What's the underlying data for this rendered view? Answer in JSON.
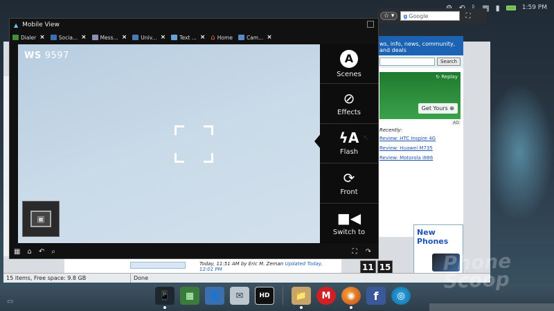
{
  "statusbar": {
    "time": "1:59 PM"
  },
  "camera_window": {
    "title": "Mobile View",
    "tabs": [
      {
        "label": "Dialer",
        "color": "#3f8f3f"
      },
      {
        "label": "Socia...",
        "color": "#3a6fb0"
      },
      {
        "label": "Mess...",
        "color": "#8a8fb8"
      },
      {
        "label": "Univ...",
        "color": "#4a7ab0"
      },
      {
        "label": "Text ...",
        "color": "#6aa0d8"
      },
      {
        "label": "Home",
        "color": "#d8d8d8"
      },
      {
        "label": "Cam...",
        "color": "#5a8ac8"
      }
    ],
    "viewfinder_label_prefix": "WS",
    "viewfinder_label_number": "9597",
    "controls": {
      "scenes": "Scenes",
      "effects": "Effects",
      "flash": "Flash",
      "front": "Front",
      "switch_to": "Switch to"
    }
  },
  "browser": {
    "google_placeholder": "Google",
    "tagline": "ws, info, news, community, and deals",
    "search_button": "Search",
    "ad_replay": "Replay",
    "ad_cta": "Get Yours",
    "ad_tag": "AD",
    "recently_title": "Recently:",
    "recent_links": [
      "Review: HTC Inspire 4G",
      "Review: Huawei M735",
      "Review: Motorola i886"
    ],
    "new_phones": "New Phones",
    "article_date": "Today, 11:51 AM",
    "article_author": "by Eric M. Zeman",
    "article_updated": "Updated Today, 12:01 PM",
    "clock_digits": [
      "11",
      "15"
    ],
    "status_items": "15 items, Free space: 9.8 GB",
    "status_done": "Done"
  },
  "dock": {
    "items": [
      {
        "name": "phone",
        "glyph": "📱"
      },
      {
        "name": "apps-grid",
        "glyph": "▦"
      },
      {
        "name": "contacts",
        "glyph": "👤"
      },
      {
        "name": "mail",
        "glyph": "✉"
      },
      {
        "name": "hd",
        "glyph": "HD"
      },
      {
        "name": "folder",
        "glyph": "📁"
      },
      {
        "name": "motorola",
        "glyph": "M"
      },
      {
        "name": "firefox",
        "glyph": "◉"
      },
      {
        "name": "facebook",
        "glyph": "f"
      },
      {
        "name": "att",
        "glyph": "◎"
      }
    ]
  },
  "watermark": "Phone Scoop"
}
